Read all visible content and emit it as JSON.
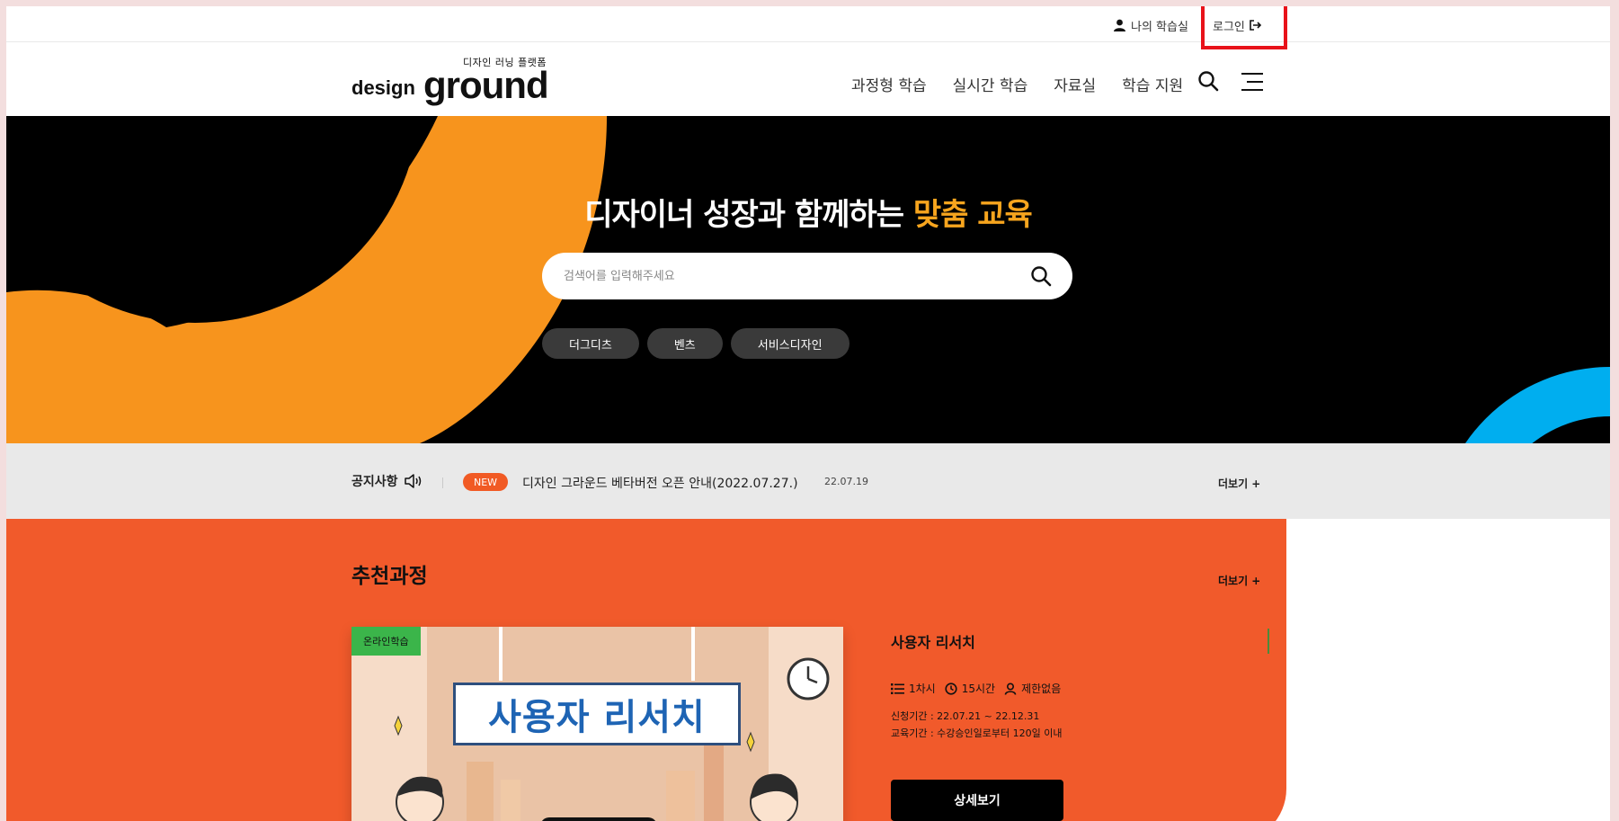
{
  "utility": {
    "my_classroom": "나의 학습실",
    "login": "로그인"
  },
  "logo": {
    "tagline": "디자인 러닝 플랫폼",
    "word": "design",
    "ground": "ground"
  },
  "nav": {
    "items": [
      "과정형 학습",
      "실시간 학습",
      "자료실",
      "학습 지원"
    ]
  },
  "hero": {
    "title_main": "디자이너 성장과 함께하는 ",
    "title_accent": "맞춤 교육",
    "search_placeholder": "검색어를 입력해주세요",
    "chips": [
      "더그디츠",
      "벤츠",
      "서비스디자인"
    ],
    "accent_color": "#f7a51e"
  },
  "notice": {
    "label": "공지사항",
    "badge": "NEW",
    "text": "디자인 그라운드 베타버전 오픈 안내(2022.07.27.)",
    "date": "22.07.19",
    "more": "더보기 +"
  },
  "recommended": {
    "title": "추천과정",
    "more": "더보기 +",
    "course": {
      "badge": "온라인학습",
      "thumb_title": "사용자 리서치",
      "name": "사용자 리서치",
      "sessions": "1차시",
      "hours": "15시간",
      "limit": "제한없음",
      "apply_period": "신청기간 : 22.07.21 ~ 22.12.31",
      "study_period": "교육기간 : 수강승인일로부터 120일 이내",
      "detail_button": "상세보기"
    }
  },
  "colors": {
    "brand_orange": "#f15a2b",
    "hero_orange": "#f7941d",
    "hero_blue": "#00aeef",
    "highlight_red": "#e8121a"
  }
}
